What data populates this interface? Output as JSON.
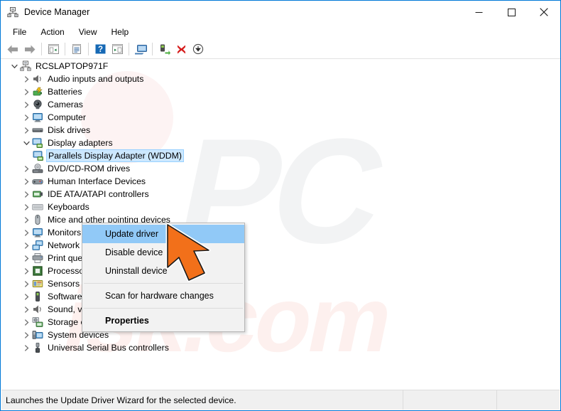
{
  "window": {
    "title": "Device Manager",
    "title_icon": "device-manager-icon",
    "accent": "#0078d7"
  },
  "caption": {
    "minimize": "─",
    "maximize": "□",
    "close": "✕"
  },
  "menubar": {
    "items": [
      {
        "label": "File"
      },
      {
        "label": "Action"
      },
      {
        "label": "View"
      },
      {
        "label": "Help"
      }
    ]
  },
  "toolbar": {
    "buttons": [
      {
        "name": "back-button",
        "icon": "back-arrow-icon"
      },
      {
        "name": "forward-button",
        "icon": "forward-arrow-icon"
      },
      {
        "name": "show-hide-console-tree-button",
        "icon": "console-tree-icon"
      },
      {
        "name": "properties-button",
        "icon": "properties-window-icon"
      },
      {
        "name": "help-button",
        "icon": "help-question-icon"
      },
      {
        "name": "action-menu-button",
        "icon": "action-pane-icon"
      },
      {
        "name": "scan-hardware-changes-button",
        "icon": "monitor-scan-icon"
      },
      {
        "name": "update-driver-button",
        "icon": "update-driver-icon"
      },
      {
        "name": "uninstall-device-button",
        "icon": "red-x-icon"
      },
      {
        "name": "disable-device-button",
        "icon": "down-arrow-circle-icon"
      }
    ]
  },
  "tree": {
    "root": {
      "label": "RCSLAPTOP971F",
      "icon": "computer-root-icon",
      "expanded": true
    },
    "items": [
      {
        "label": "Audio inputs and outputs",
        "icon": "speaker-icon",
        "indent": 1,
        "expanded": false
      },
      {
        "label": "Batteries",
        "icon": "battery-icon",
        "indent": 1,
        "expanded": false
      },
      {
        "label": "Cameras",
        "icon": "camera-icon",
        "indent": 1,
        "expanded": false
      },
      {
        "label": "Computer",
        "icon": "monitor-icon",
        "indent": 1,
        "expanded": false
      },
      {
        "label": "Disk drives",
        "icon": "disk-drive-icon",
        "indent": 1,
        "expanded": false
      },
      {
        "label": "Display adapters",
        "icon": "display-adapter-icon",
        "indent": 1,
        "expanded": true
      },
      {
        "label": "Parallels Display Adapter (WDDM)",
        "icon": "display-adapter-icon",
        "indent": 2,
        "selected": true
      },
      {
        "label": "DVD/CD-ROM drives",
        "icon": "dvd-drive-icon",
        "indent": 1,
        "expanded": false
      },
      {
        "label": "Human Interface Devices",
        "icon": "hid-icon",
        "indent": 1,
        "expanded": false
      },
      {
        "label": "IDE ATA/ATAPI controllers",
        "icon": "ide-controller-icon",
        "indent": 1,
        "expanded": false
      },
      {
        "label": "Keyboards",
        "icon": "keyboard-icon",
        "indent": 1,
        "expanded": false
      },
      {
        "label": "Mice and other pointing devices",
        "icon": "mouse-icon",
        "indent": 1,
        "expanded": false
      },
      {
        "label": "Monitors",
        "icon": "monitor-icon",
        "indent": 1,
        "expanded": false
      },
      {
        "label": "Network adapters",
        "icon": "network-adapter-icon",
        "indent": 1,
        "expanded": false
      },
      {
        "label": "Print queues",
        "icon": "printer-icon",
        "indent": 1,
        "expanded": false
      },
      {
        "label": "Processors",
        "icon": "processor-icon",
        "indent": 1,
        "expanded": false
      },
      {
        "label": "Sensors",
        "icon": "sensor-icon",
        "indent": 1,
        "expanded": false
      },
      {
        "label": "Software devices",
        "icon": "software-device-icon",
        "indent": 1,
        "expanded": false
      },
      {
        "label": "Sound, video and game controllers",
        "icon": "speaker-icon",
        "indent": 1,
        "expanded": false
      },
      {
        "label": "Storage controllers",
        "icon": "storage-controller-icon",
        "indent": 1,
        "expanded": false
      },
      {
        "label": "System devices",
        "icon": "system-device-icon",
        "indent": 1,
        "expanded": false
      },
      {
        "label": "Universal Serial Bus controllers",
        "icon": "usb-icon",
        "indent": 1,
        "expanded": false
      }
    ]
  },
  "context_menu": {
    "items": [
      {
        "label": "Update driver",
        "highlighted": true,
        "bold": false
      },
      {
        "label": "Disable device",
        "highlighted": false,
        "bold": false
      },
      {
        "label": "Uninstall device",
        "highlighted": false,
        "bold": false
      },
      {
        "separator": true
      },
      {
        "label": "Scan for hardware changes",
        "highlighted": false,
        "bold": false
      },
      {
        "separator": true
      },
      {
        "label": "Properties",
        "highlighted": false,
        "bold": true
      }
    ],
    "highlight_color": "#91c9f7"
  },
  "statusbar": {
    "message": "Launches the Update Driver Wizard for the selected device.",
    "cell_1": "",
    "cell_2": ""
  },
  "watermark": {
    "primary": "PC",
    "secondary": "isk.com"
  }
}
